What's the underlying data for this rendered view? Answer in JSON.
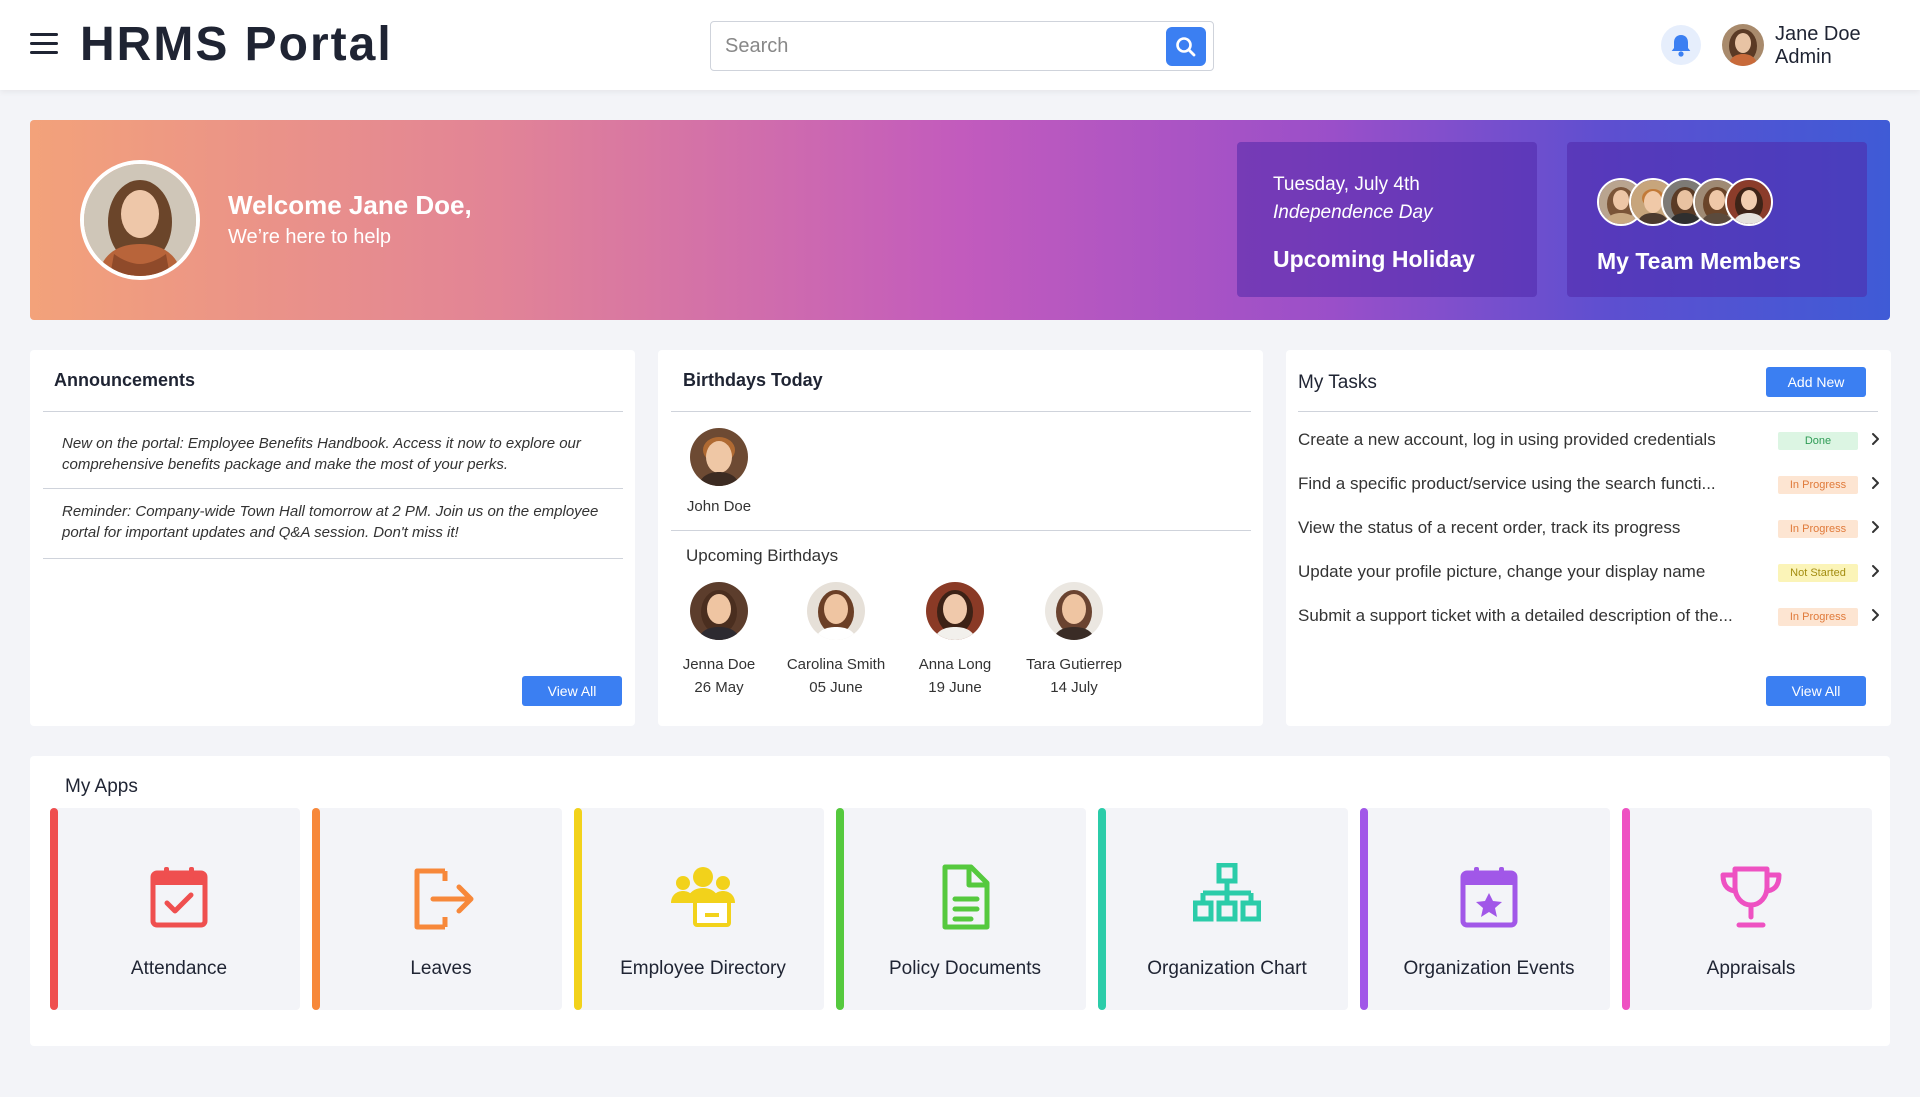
{
  "header": {
    "title": "HRMS Portal",
    "search_placeholder": "Search",
    "user_name": "Jane Doe",
    "user_role": "Admin"
  },
  "banner": {
    "welcome_title": "Welcome Jane Doe,",
    "welcome_sub": "We’re here to help",
    "holiday": {
      "date": "Tuesday, July 4th",
      "name": "Independence Day",
      "label": "Upcoming Holiday"
    },
    "team": {
      "label": "My Team Members"
    }
  },
  "announcements": {
    "title": "Announcements",
    "items": [
      "New on the portal: Employee Benefits Handbook. Access it now to explore our comprehensive benefits package and make the most of your perks.",
      "Reminder: Company-wide Town Hall tomorrow at 2 PM. Join us on the employee portal for important updates and Q&A session. Don't miss it!"
    ],
    "view_all": "View All"
  },
  "birthdays": {
    "title": "Birthdays Today",
    "today": {
      "name": "John Doe"
    },
    "upcoming_label": "Upcoming Birthdays",
    "upcoming": [
      {
        "name": "Jenna Doe",
        "date": "26 May"
      },
      {
        "name": "Carolina Smith",
        "date": "05 June"
      },
      {
        "name": "Anna Long",
        "date": "19 June"
      },
      {
        "name": "Tara Gutierrep",
        "date": "14 July"
      }
    ]
  },
  "tasks": {
    "title": "My Tasks",
    "add_new": "Add New",
    "view_all": "View All",
    "items": [
      {
        "text": "Create a new account, log in using provided credentials",
        "status": "Done"
      },
      {
        "text": "Find a specific product/service using the search functi...",
        "status": "In Progress"
      },
      {
        "text": "View the status of a recent order, track its progress",
        "status": "In Progress"
      },
      {
        "text": "Update your profile picture, change your display name",
        "status": "Not Started"
      },
      {
        "text": "Submit a support ticket with a detailed description of the...",
        "status": "In Progress"
      }
    ],
    "status_colors": {
      "Done": {
        "bg": "#dcf5e3",
        "fg": "#2e9b55"
      },
      "In Progress": {
        "bg": "#fde5d2",
        "fg": "#e07a3a"
      },
      "Not Started": {
        "bg": "#fbf4b8",
        "fg": "#a38d10"
      }
    }
  },
  "apps": {
    "title": "My Apps",
    "items": [
      {
        "label": "Attendance",
        "icon": "calendar-check-icon",
        "color": "#ef4f4f"
      },
      {
        "label": "Leaves",
        "icon": "exit-icon",
        "color": "#f7883a"
      },
      {
        "label": "Employee Directory",
        "icon": "people-icon",
        "color": "#f2d21b"
      },
      {
        "label": "Policy Documents",
        "icon": "document-icon",
        "color": "#55c93e"
      },
      {
        "label": "Organization Chart",
        "icon": "org-chart-icon",
        "color": "#2bcca9"
      },
      {
        "label": "Organization Events",
        "icon": "calendar-star-icon",
        "color": "#a157e8"
      },
      {
        "label": "Appraisals",
        "icon": "trophy-icon",
        "color": "#ee51c2"
      }
    ]
  },
  "colors": {
    "accent": "#3b7ff2",
    "text_dark": "#1f2433",
    "background": "#f3f4f8"
  }
}
